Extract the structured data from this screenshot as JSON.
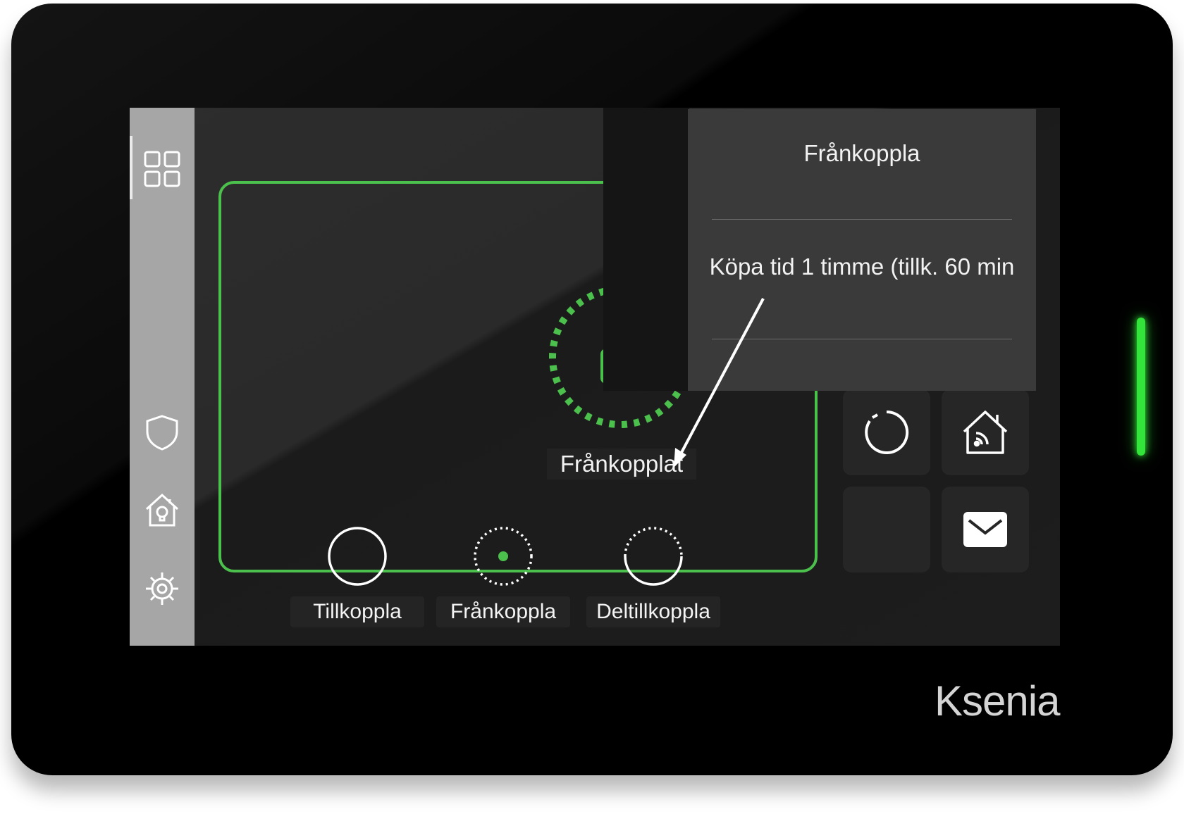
{
  "brand": "Ksenia",
  "status": {
    "label": "Frånkopplat",
    "icon": "unlocked-padlock-icon"
  },
  "modes": [
    {
      "label": "Tillkoppla",
      "icon": "solid-ring-icon"
    },
    {
      "label": "Frånkoppla",
      "icon": "dotted-ring-dot-icon"
    },
    {
      "label": "Deltillkoppla",
      "icon": "partial-ring-icon"
    }
  ],
  "popup": {
    "title": "Frånkoppla",
    "option": "Köpa tid 1 timme (tillk. 60 min"
  },
  "sidebar": {
    "items": [
      "dashboard-grid-icon",
      "shield-icon",
      "smart-home-icon",
      "settings-gear-icon"
    ]
  },
  "tiles": [
    "refresh-ring-icon",
    "smart-home-wifi-icon",
    "empty",
    "mail-envelope-icon"
  ],
  "colors": {
    "accent": "#4cc04c",
    "led": "#33e53a",
    "sidebar": "#a6a6a6",
    "popup": "#3a3a3a"
  }
}
